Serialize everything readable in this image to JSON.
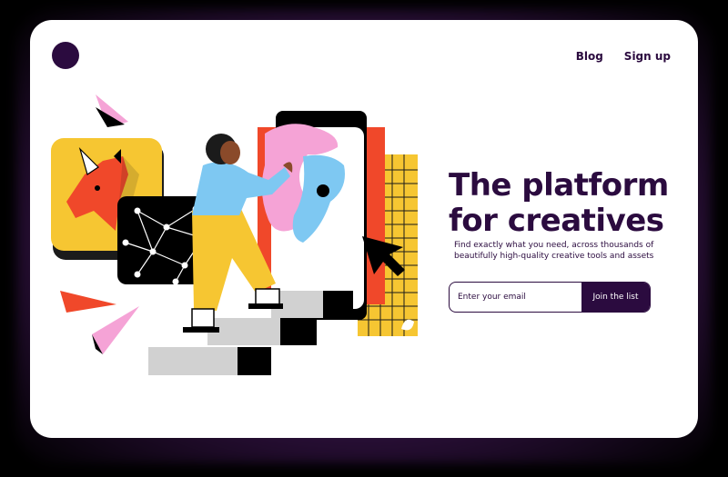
{
  "nav": {
    "blog": "Blog",
    "signup": "Sign up"
  },
  "hero": {
    "headline": "The platform for creatives",
    "subtext": "Find exactly what you need, across thousands of beautifully high-quality creative tools and assets"
  },
  "form": {
    "placeholder": "Enter your email",
    "button_label": "Join the list"
  },
  "colors": {
    "brand": "#2b0b3f",
    "yellow": "#f6c632",
    "red": "#f0482a",
    "pink": "#f5a3d6",
    "blue": "#7ec8f2",
    "gray": "#d1d1d1"
  },
  "icons": [
    "logo-icon",
    "unicorn-icon",
    "cursor-icon",
    "network-icon"
  ]
}
